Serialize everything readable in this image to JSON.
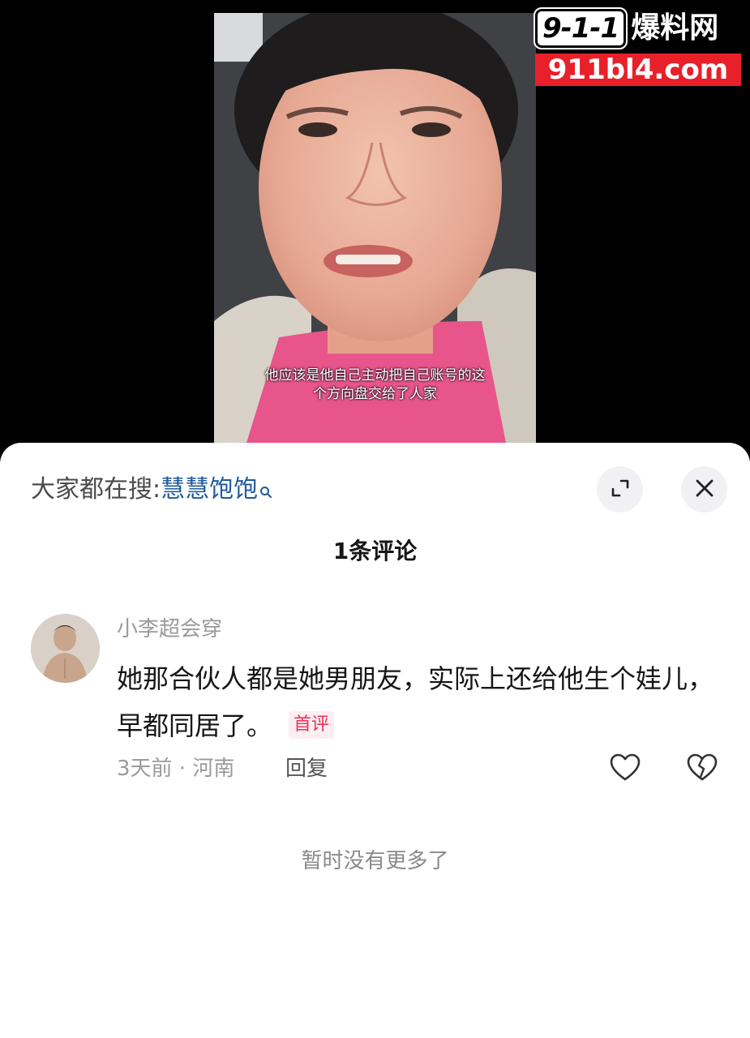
{
  "video": {
    "subtitle_line1": "他应该是他自己主动把自己账号的这",
    "subtitle_line2": "个方向盘交给了人家"
  },
  "watermark": {
    "badge": "9-1-1",
    "title": "爆料网",
    "url": "911bl4.com"
  },
  "sheet": {
    "search_prefix": "大家都在搜:",
    "search_term": "慧慧饱饱",
    "comment_count": "1条评论",
    "no_more": "暂时没有更多了"
  },
  "comment": {
    "username": "小李超会穿",
    "text": "她那合伙人都是她男朋友，实际上还给他生个娃儿，早都同居了。",
    "badge": "首评",
    "meta": "3天前 · 河南",
    "reply": "回复"
  },
  "icons": {
    "search": "search-icon",
    "expand": "expand-icon",
    "close": "close-icon",
    "like": "heart-icon",
    "dislike": "broken-heart-icon"
  },
  "colors": {
    "search_term": "#1e5a9c",
    "badge_text": "#e8325a",
    "badge_bg": "#fdeef1",
    "watermark_red": "#e8202a"
  }
}
